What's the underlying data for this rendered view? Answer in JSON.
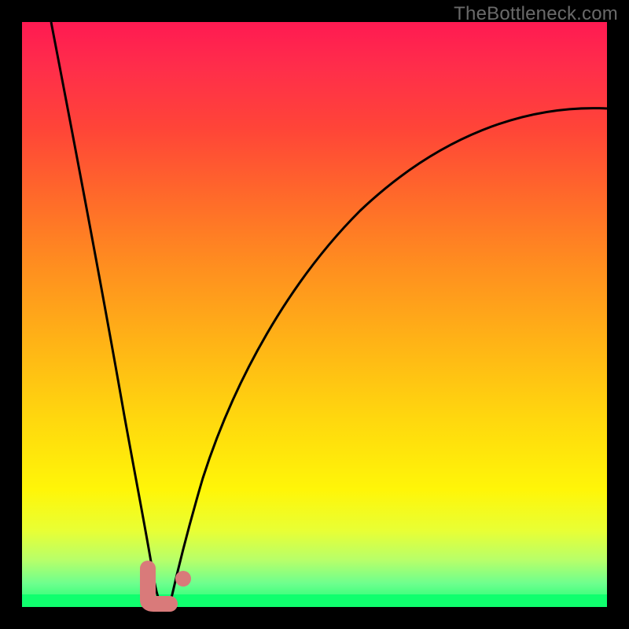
{
  "watermark": "TheBottleneck.com",
  "colors": {
    "frame": "#000000",
    "curve": "#000000",
    "marker": "#d97a7a"
  },
  "chart_data": {
    "type": "line",
    "title": "",
    "xlabel": "",
    "ylabel": "",
    "xlim": [
      0,
      100
    ],
    "ylim": [
      0,
      100
    ],
    "grid": false,
    "legend": false,
    "series": [
      {
        "name": "left-branch",
        "x": [
          5,
          7,
          9,
          11,
          13,
          15,
          17,
          19,
          20,
          21,
          22,
          23
        ],
        "y": [
          100,
          83,
          68,
          54,
          42,
          31,
          21,
          12,
          8,
          5,
          2.5,
          1
        ]
      },
      {
        "name": "right-branch",
        "x": [
          25,
          26,
          27,
          29,
          32,
          36,
          41,
          47,
          54,
          62,
          71,
          81,
          92,
          100
        ],
        "y": [
          1,
          3,
          6,
          11,
          18,
          27,
          37,
          47,
          56,
          64,
          71,
          77,
          82,
          85
        ]
      }
    ],
    "markers": [
      {
        "name": "left-L-stroke-vertical",
        "shape": "round-line",
        "x": [
          21.5,
          21.5
        ],
        "y": [
          6,
          0.5
        ],
        "width": 4,
        "color": "#d97a7a"
      },
      {
        "name": "left-L-stroke-horizontal",
        "shape": "round-line",
        "x": [
          21.5,
          25
        ],
        "y": [
          0.7,
          0.7
        ],
        "width": 4,
        "color": "#d97a7a"
      },
      {
        "name": "right-dot",
        "shape": "dot",
        "x": 27,
        "y": 4.5,
        "r": 2,
        "color": "#d97a7a"
      }
    ],
    "background_gradient": {
      "type": "vertical",
      "stops": [
        {
          "pos": 0.0,
          "color": "#ff1a52"
        },
        {
          "pos": 0.3,
          "color": "#ff6a2a"
        },
        {
          "pos": 0.68,
          "color": "#ffd80e"
        },
        {
          "pos": 0.87,
          "color": "#e8ff35"
        },
        {
          "pos": 1.0,
          "color": "#17ff6e"
        }
      ]
    }
  }
}
